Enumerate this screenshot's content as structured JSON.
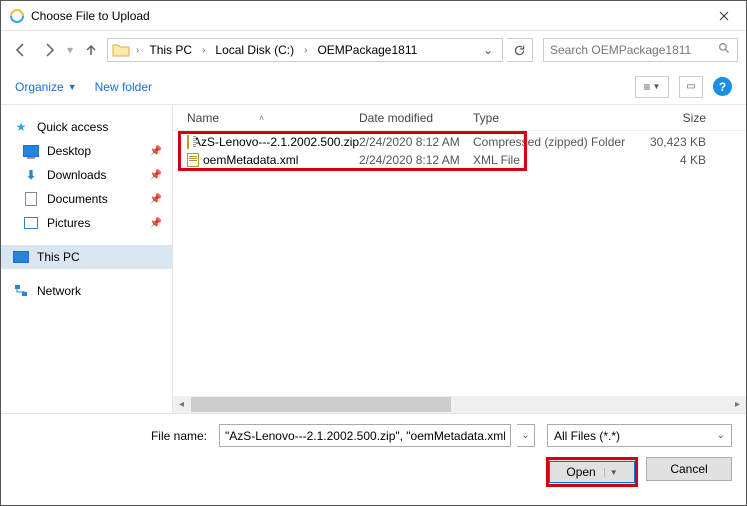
{
  "window": {
    "title": "Choose File to Upload"
  },
  "breadcrumb": {
    "seg1": "This PC",
    "seg2": "Local Disk (C:)",
    "seg3": "OEMPackage1811"
  },
  "search": {
    "placeholder": "Search OEMPackage1811"
  },
  "toolbar": {
    "organize": "Organize",
    "newfolder": "New folder"
  },
  "sidebar": {
    "quick": "Quick access",
    "desktop": "Desktop",
    "downloads": "Downloads",
    "documents": "Documents",
    "pictures": "Pictures",
    "thispc": "This PC",
    "network": "Network"
  },
  "columns": {
    "name": "Name",
    "date": "Date modified",
    "type": "Type",
    "size": "Size"
  },
  "files": [
    {
      "name": "AzS-Lenovo---2.1.2002.500.zip",
      "date": "2/24/2020 8:12 AM",
      "type": "Compressed (zipped) Folder",
      "size": "30,423 KB"
    },
    {
      "name": "oemMetadata.xml",
      "date": "2/24/2020 8:12 AM",
      "type": "XML File",
      "size": "4 KB"
    }
  ],
  "footer": {
    "filenamelabel": "File name:",
    "filenamevalue": "\"AzS-Lenovo---2.1.2002.500.zip\", \"oemMetadata.xml\"",
    "filter": "All Files (*.*)",
    "open": "Open",
    "cancel": "Cancel"
  }
}
